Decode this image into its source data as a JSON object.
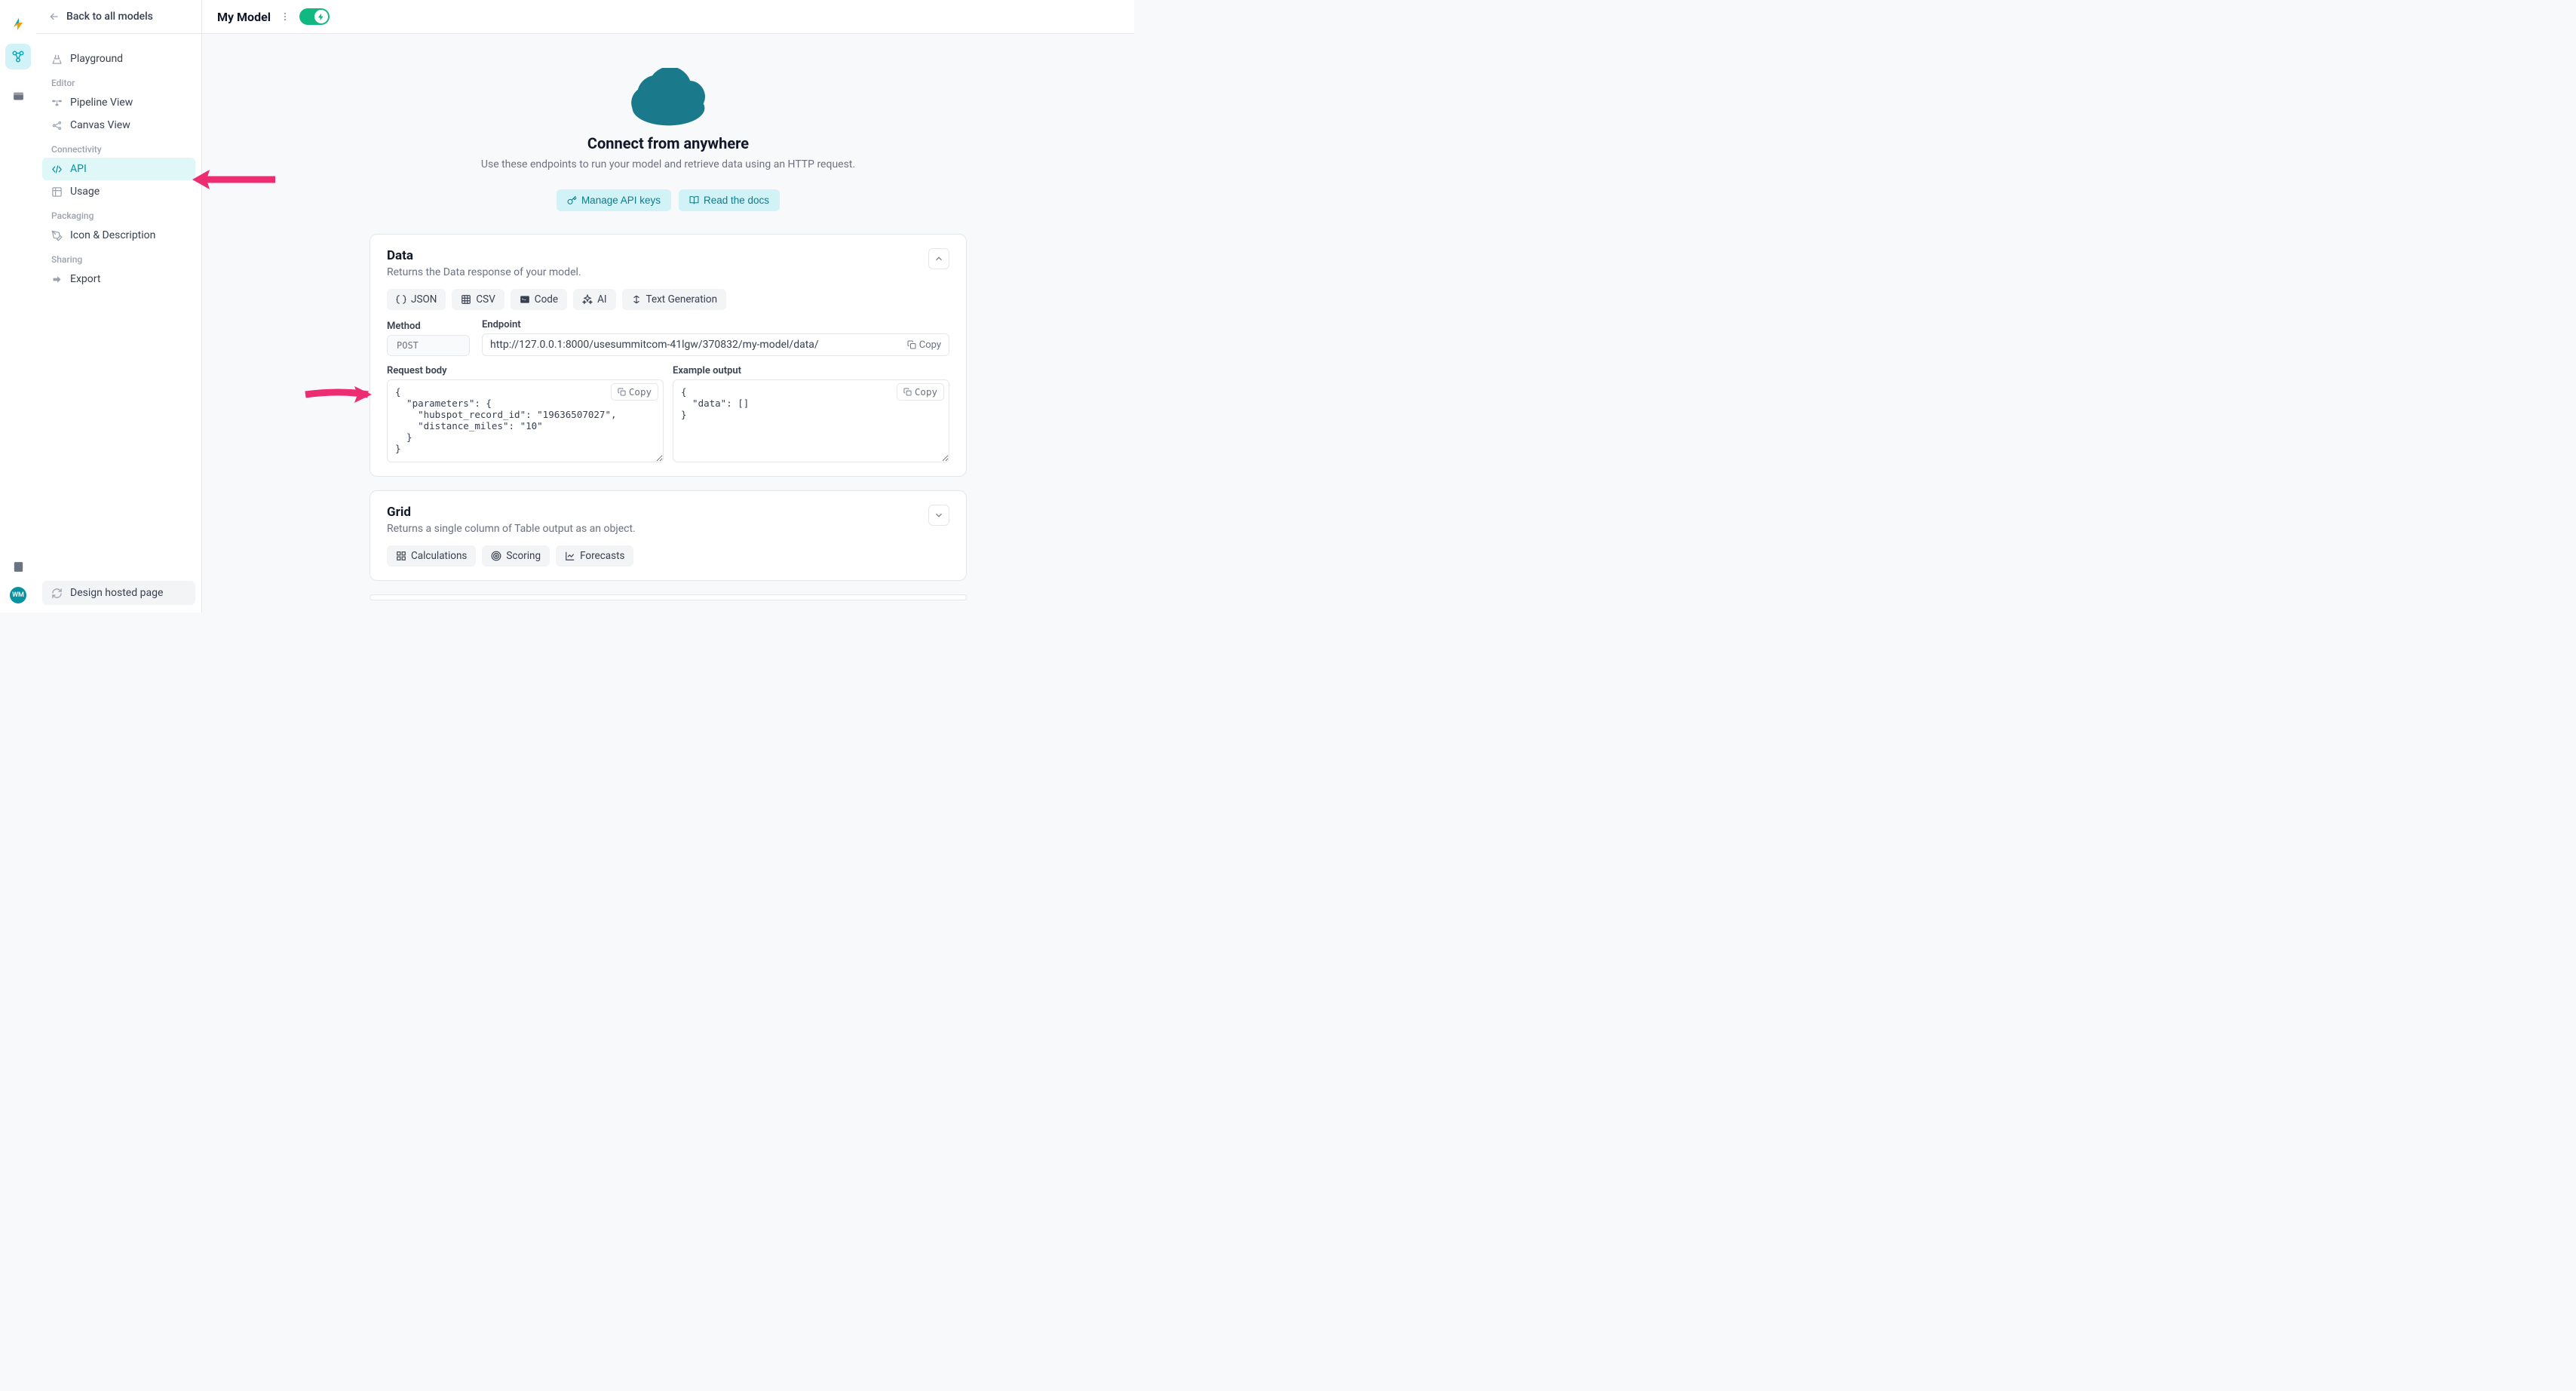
{
  "backLink": "Back to all models",
  "modelTitle": "My Model",
  "ui": {
    "copy": "Copy"
  },
  "sidebar": {
    "playground": "Playground",
    "editorLabel": "Editor",
    "pipeline": "Pipeline View",
    "canvas": "Canvas View",
    "connectivityLabel": "Connectivity",
    "api": "API",
    "usage": "Usage",
    "packagingLabel": "Packaging",
    "iconDesc": "Icon & Description",
    "sharingLabel": "Sharing",
    "export": "Export",
    "hosted": "Design hosted page"
  },
  "railAvatar": "WM",
  "hero": {
    "title": "Connect from anywhere",
    "subtitle": "Use these endpoints to run your model and retrieve data using an HTTP request.",
    "manageKeys": "Manage API keys",
    "readDocs": "Read the docs"
  },
  "dataCard": {
    "title": "Data",
    "subtitle": "Returns the Data response of your model.",
    "tabs": {
      "json": "JSON",
      "csv": "CSV",
      "code": "Code",
      "ai": "AI",
      "text": "Text Generation"
    },
    "methodLabel": "Method",
    "method": "POST",
    "endpointLabel": "Endpoint",
    "endpoint": "http://127.0.0.1:8000/usesummitcom-41lgw/370832/my-model/data/",
    "reqLabel": "Request body",
    "reqBody": "{\n  \"parameters\": {\n    \"hubspot_record_id\": \"19636507027\",\n    \"distance_miles\": \"10\"\n  }\n}",
    "exLabel": "Example output",
    "exBody": "{\n  \"data\": []\n}"
  },
  "gridCard": {
    "title": "Grid",
    "subtitle": "Returns a single column of Table output as an object.",
    "tabs": {
      "calc": "Calculations",
      "scoring": "Scoring",
      "forecasts": "Forecasts"
    }
  }
}
